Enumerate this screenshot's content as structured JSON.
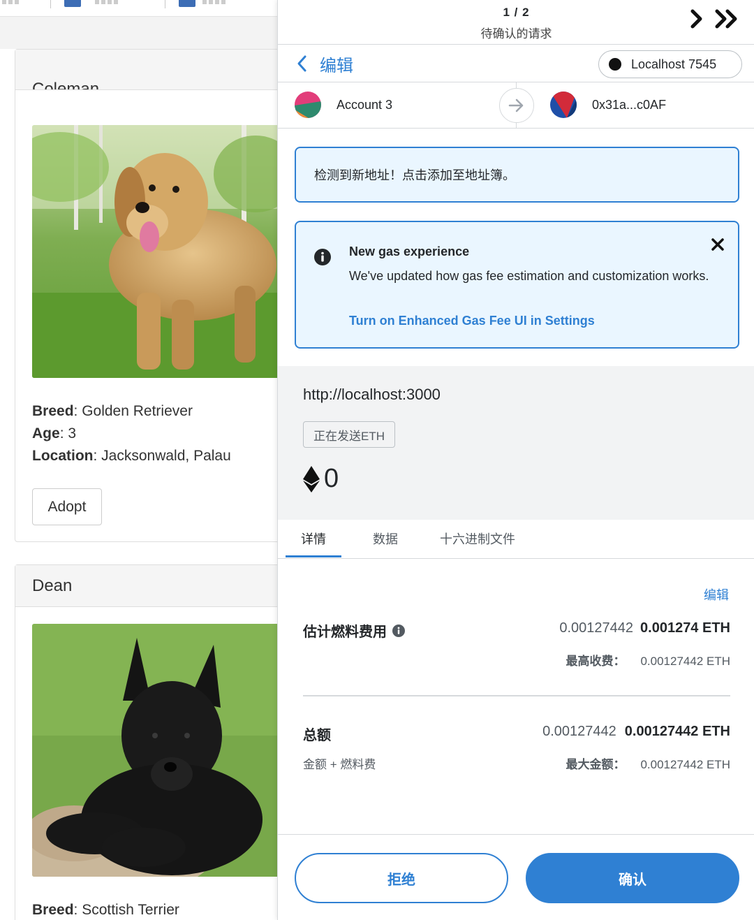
{
  "background_page": {
    "cards": [
      {
        "name": "Coleman",
        "breed_label": "Breed",
        "breed": "Golden Retriever",
        "age_label": "Age",
        "age": "3",
        "location_label": "Location",
        "location": "Jacksonwald, Palau",
        "adopt_label": "Adopt"
      },
      {
        "name": "Dean",
        "breed_label": "Breed",
        "breed": "Scottish Terrier"
      }
    ]
  },
  "metamask": {
    "nav": {
      "count": "1 / 2",
      "pending_label": "待确认的请求"
    },
    "edit_label": "编辑",
    "network": "Localhost 7545",
    "from_account": "Account 3",
    "to_address": "0x31a...c0AF",
    "new_address_notice": "检测到新地址！点击添加至地址簿。",
    "gas_notice": {
      "title": "New gas experience",
      "body": "We've updated how gas fee estimation and customization works.",
      "link": "Turn on Enhanced Gas Fee UI in Settings"
    },
    "summary": {
      "origin": "http://localhost:3000",
      "method": "正在发送ETH",
      "amount": "0"
    },
    "tabs": [
      "详情",
      "数据",
      "十六进制文件"
    ],
    "details": {
      "edit_link": "编辑",
      "fee_label": "估计燃料费用",
      "fee_secondary": "0.00127442",
      "fee_primary": "0.001274 ETH",
      "max_fee_label": "最高收费：",
      "max_fee_value": "0.00127442 ETH",
      "total_label": "总额",
      "total_secondary": "0.00127442",
      "total_primary": "0.00127442 ETH",
      "total_sub_label": "金额 + 燃料费",
      "max_amount_label": "最大金额：",
      "max_amount_value": "0.00127442 ETH"
    },
    "footer": {
      "reject": "拒绝",
      "confirm": "确认"
    },
    "colors": {
      "accent": "#2f80d3",
      "notice_bg": "#eaf6ff",
      "summary_bg": "#f2f3f4"
    }
  }
}
